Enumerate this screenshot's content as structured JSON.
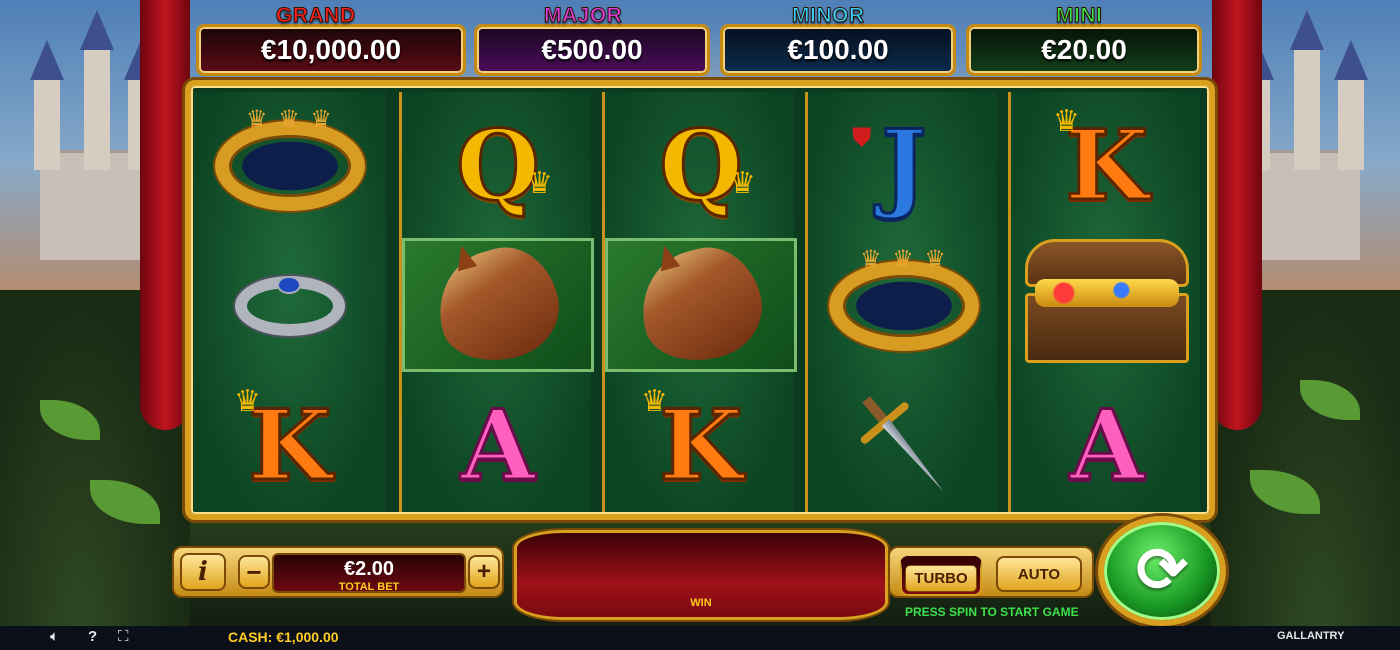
{
  "jackpots": [
    {
      "label": "GRAND",
      "amount": "€10,000.00",
      "color": "#ff2020"
    },
    {
      "label": "MAJOR",
      "amount": "€500.00",
      "color": "#e040e0"
    },
    {
      "label": "MINOR",
      "amount": "€100.00",
      "color": "#3ad0ff"
    },
    {
      "label": "MINI",
      "amount": "€20.00",
      "color": "#3ee04a"
    }
  ],
  "reels": [
    [
      "crown",
      "ring",
      "K"
    ],
    [
      "Q",
      "horse",
      "A"
    ],
    [
      "Q",
      "horse",
      "K"
    ],
    [
      "J",
      "crown",
      "sword"
    ],
    [
      "K",
      "treasure-chest",
      "A"
    ]
  ],
  "controls": {
    "info": "i",
    "minus": "−",
    "plus": "+",
    "bet_value": "€2.00",
    "bet_label": "TOTAL BET",
    "win_label": "WIN",
    "turbo": "TURBO",
    "auto": "AUTO",
    "spin_icon": "spin-icon",
    "hint": "PRESS SPIN TO START GAME"
  },
  "footer": {
    "cash_label": "CASH:",
    "cash_value": "€1,000.00",
    "game_name": "GALLANTRY",
    "icons": [
      "sound-icon",
      "help-icon",
      "fullscreen-icon"
    ]
  }
}
